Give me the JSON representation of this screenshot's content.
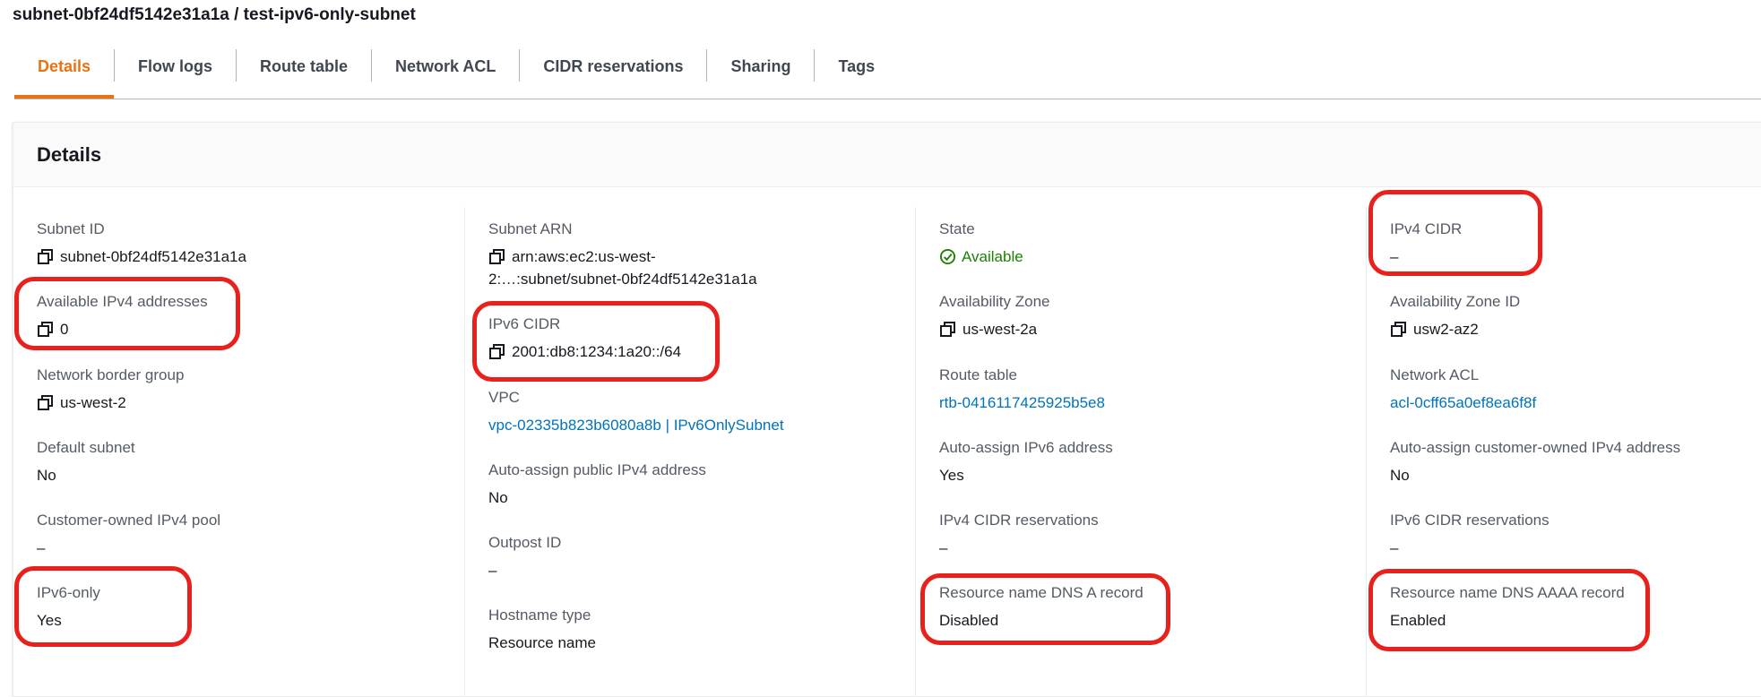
{
  "page": {
    "title": "subnet-0bf24df5142e31a1a / test-ipv6-only-subnet"
  },
  "tabs": [
    {
      "label": "Details",
      "active": true
    },
    {
      "label": "Flow logs"
    },
    {
      "label": "Route table"
    },
    {
      "label": "Network ACL"
    },
    {
      "label": "CIDR reservations"
    },
    {
      "label": "Sharing"
    },
    {
      "label": "Tags"
    }
  ],
  "panel": {
    "title": "Details"
  },
  "col1": {
    "subnet_id": {
      "label": "Subnet ID",
      "value": "subnet-0bf24df5142e31a1a"
    },
    "available_ipv4": {
      "label": "Available IPv4 addresses",
      "value": "0"
    },
    "border_group": {
      "label": "Network border group",
      "value": "us-west-2"
    },
    "default_subnet": {
      "label": "Default subnet",
      "value": "No"
    },
    "coip_pool": {
      "label": "Customer-owned IPv4 pool",
      "value": "–"
    },
    "ipv6_only": {
      "label": "IPv6-only",
      "value": "Yes"
    }
  },
  "col2": {
    "subnet_arn": {
      "label": "Subnet ARN",
      "line1": "arn:aws:ec2:us-west-",
      "line2": "2:…:subnet/subnet-0bf24df5142e31a1a"
    },
    "ipv6_cidr": {
      "label": "IPv6 CIDR",
      "value": "2001:db8:1234:1a20::/64"
    },
    "vpc": {
      "label": "VPC",
      "value": "vpc-02335b823b6080a8b | IPv6OnlySubnet"
    },
    "auto_public_ipv4": {
      "label": "Auto-assign public IPv4 address",
      "value": "No"
    },
    "outpost_id": {
      "label": "Outpost ID",
      "value": "–"
    },
    "hostname_type": {
      "label": "Hostname type",
      "value": "Resource name"
    }
  },
  "col3": {
    "state": {
      "label": "State",
      "value": "Available"
    },
    "az": {
      "label": "Availability Zone",
      "value": "us-west-2a"
    },
    "route_table": {
      "label": "Route table",
      "value": "rtb-0416117425925b5e8"
    },
    "auto_ipv6": {
      "label": "Auto-assign IPv6 address",
      "value": "Yes"
    },
    "ipv4_cidr_res": {
      "label": "IPv4 CIDR reservations",
      "value": "–"
    },
    "dns_a": {
      "label": "Resource name DNS A record",
      "value": "Disabled"
    }
  },
  "col4": {
    "ipv4_cidr": {
      "label": "IPv4 CIDR",
      "value": "–"
    },
    "az_id": {
      "label": "Availability Zone ID",
      "value": "usw2-az2"
    },
    "network_acl": {
      "label": "Network ACL",
      "value": "acl-0cff65a0ef8ea6f8f"
    },
    "auto_coip": {
      "label": "Auto-assign customer-owned IPv4 address",
      "value": "No"
    },
    "ipv6_cidr_res": {
      "label": "IPv6 CIDR reservations",
      "value": "–"
    },
    "dns_aaaa": {
      "label": "Resource name DNS AAAA record",
      "value": "Enabled"
    }
  },
  "colors": {
    "accent": "#ec7211",
    "link": "#0073bb",
    "success": "#1d8102",
    "highlight": "#e8211c"
  },
  "icons": {
    "copy": "copy-icon",
    "status": "check-circle-icon"
  }
}
